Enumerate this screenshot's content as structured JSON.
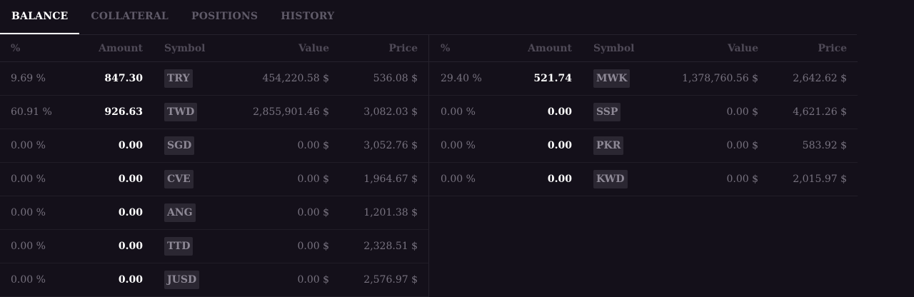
{
  "tabs": [
    {
      "label": "BALANCE",
      "active": true
    },
    {
      "label": "COLLATERAL",
      "active": false
    },
    {
      "label": "POSITIONS",
      "active": false
    },
    {
      "label": "HISTORY",
      "active": false
    }
  ],
  "columns": {
    "pct": "%",
    "amount": "Amount",
    "symbol": "Symbol",
    "value": "Value",
    "price": "Price"
  },
  "left_rows": [
    {
      "pct": "9.69 %",
      "amount": "847.30",
      "symbol": "TRY",
      "value": "454,220.58 $",
      "price": "536.08 $"
    },
    {
      "pct": "60.91 %",
      "amount": "926.63",
      "symbol": "TWD",
      "value": "2,855,901.46 $",
      "price": "3,082.03 $"
    },
    {
      "pct": "0.00 %",
      "amount": "0.00",
      "symbol": "SGD",
      "value": "0.00 $",
      "price": "3,052.76 $"
    },
    {
      "pct": "0.00 %",
      "amount": "0.00",
      "symbol": "CVE",
      "value": "0.00 $",
      "price": "1,964.67 $"
    },
    {
      "pct": "0.00 %",
      "amount": "0.00",
      "symbol": "ANG",
      "value": "0.00 $",
      "price": "1,201.38 $"
    },
    {
      "pct": "0.00 %",
      "amount": "0.00",
      "symbol": "TTD",
      "value": "0.00 $",
      "price": "2,328.51 $"
    },
    {
      "pct": "0.00 %",
      "amount": "0.00",
      "symbol": "JUSD",
      "value": "0.00 $",
      "price": "2,576.97 $"
    }
  ],
  "right_rows": [
    {
      "pct": "29.40 %",
      "amount": "521.74",
      "symbol": "MWK",
      "value": "1,378,760.56 $",
      "price": "2,642.62 $"
    },
    {
      "pct": "0.00 %",
      "amount": "0.00",
      "symbol": "SSP",
      "value": "0.00 $",
      "price": "4,621.26 $"
    },
    {
      "pct": "0.00 %",
      "amount": "0.00",
      "symbol": "PKR",
      "value": "0.00 $",
      "price": "583.92 $"
    },
    {
      "pct": "0.00 %",
      "amount": "0.00",
      "symbol": "KWD",
      "value": "0.00 $",
      "price": "2,015.97 $"
    }
  ]
}
